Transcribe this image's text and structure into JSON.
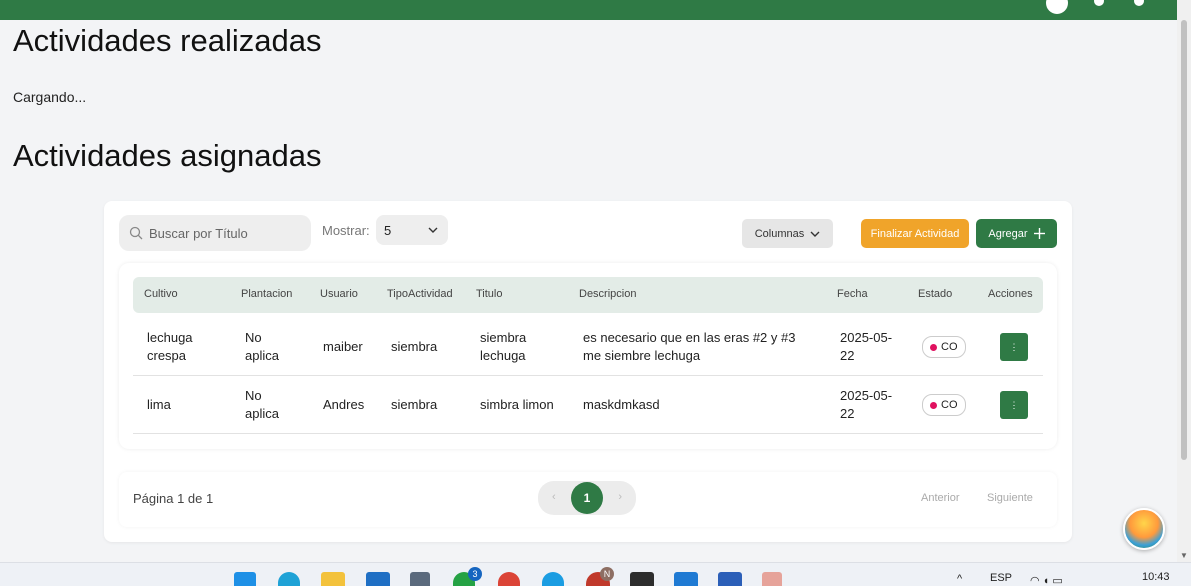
{
  "section_done": {
    "title": "Actividades realizadas",
    "status": "Cargando..."
  },
  "section_assigned": {
    "title": "Actividades asignadas"
  },
  "toolbar": {
    "search_placeholder": "Buscar por Título",
    "show_label": "Mostrar:",
    "show_value": "5",
    "columns_label": "Columnas",
    "finish_label": "Finalizar Actividad",
    "add_label": "Agregar"
  },
  "table": {
    "headers": [
      "Cultivo",
      "Plantacion",
      "Usuario",
      "TipoActividad",
      "Titulo",
      "Descripcion",
      "Fecha",
      "Estado",
      "Acciones"
    ],
    "rows": [
      {
        "cultivo": "lechuga crespa",
        "plantacion": "No aplica",
        "usuario": "maiber",
        "tipo": "siembra",
        "titulo": "siembra lechuga",
        "descripcion": "es necesario que en las eras #2 y #3 me siembre lechuga",
        "fecha": "2025-05-22",
        "estado": "CO"
      },
      {
        "cultivo": "lima",
        "plantacion": "No aplica",
        "usuario": "Andres",
        "tipo": "siembra",
        "titulo": "simbra limon",
        "descripcion": "maskdmkasd",
        "fecha": "2025-05-22",
        "estado": "CO"
      }
    ]
  },
  "pagination": {
    "info": "Página 1 de 1",
    "current": "1",
    "prev_label": "Anterior",
    "next_label": "Siguiente"
  },
  "taskbar": {
    "lang": "ESP",
    "time": "10:43",
    "whatsapp_badge": "3",
    "chrome_badge": "N"
  },
  "colors": {
    "primary": "#2f7a45",
    "accent": "#f0a42a",
    "status_dot": "#e0115f"
  }
}
